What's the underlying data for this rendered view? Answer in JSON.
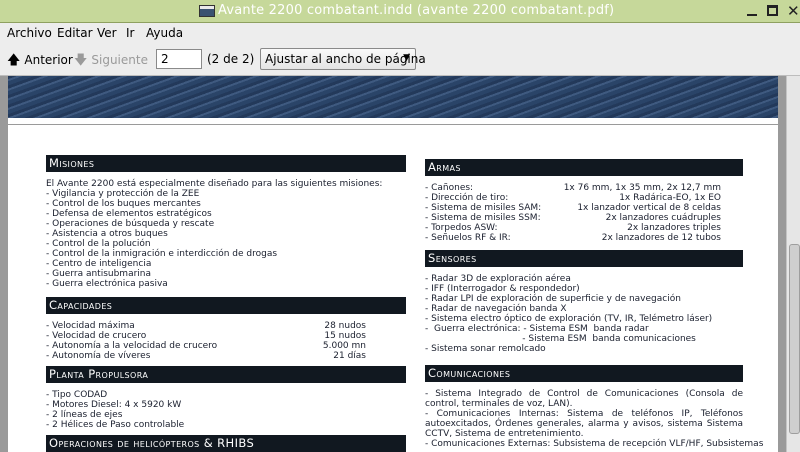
{
  "window": {
    "title": "Avante 2200 combatant.indd (avante 2200 combatant.pdf)"
  },
  "menu": [
    "Archivo",
    "Editar",
    "Ver",
    "Ir",
    "Ayuda"
  ],
  "toolbar": {
    "prev_label": "Anterior",
    "next_label": "Siguiente",
    "page_value": "2",
    "page_count": "(2 de 2)",
    "zoom_value": "Ajustar al ancho de página"
  },
  "document": {
    "misiones": {
      "title": "Misiones",
      "intro": "El Avante 2200 está especialmente diseñado para las siguientes misiones:",
      "items": [
        "- Vigilancia y protección de la ZEE",
        "- Control de los buques mercantes",
        "- Defensa de elementos estratégicos",
        "- Operaciones de búsqueda y rescate",
        "- Asistencia a otros buques",
        "- Control de la polución",
        "- Control de la inmigración e interdicción de drogas",
        "- Centro de inteligencia",
        "- Guerra antisubmarina",
        "- Guerra electrónica pasiva"
      ]
    },
    "capacidades": {
      "title": "Capacidades",
      "rows": [
        {
          "label": "- Velocidad máxima",
          "value": "28 nudos"
        },
        {
          "label": "- Velocidad de crucero",
          "value": "15 nudos"
        },
        {
          "label": "- Autonomía a la velocidad de crucero",
          "value": "5.000 mn"
        },
        {
          "label": "- Autonomía de víveres",
          "value": "21 días"
        }
      ]
    },
    "planta": {
      "title": "Planta Propulsora",
      "items": [
        "-  Tipo CODAD",
        "-  Motores Diesel: 4 x 5920 kW",
        "-  2 líneas de ejes",
        "-  2 Hélices de Paso controlable"
      ]
    },
    "operaciones": {
      "title": "Operaciones de helicópteros & RHIBS"
    },
    "armas": {
      "title": "Armas",
      "rows": [
        {
          "label": "-  Cañones:",
          "value": "1x 76 mm, 1x 35 mm, 2x 12,7 mm"
        },
        {
          "label": "-  Dirección de tiro:",
          "value": "1x Radárica-EO, 1x EO"
        },
        {
          "label": "-  Sistema de misiles SAM:",
          "value": "1x lanzador vertical de 8 celdas"
        },
        {
          "label": "-  Sistema de misiles SSM:",
          "value": "2x lanzadores cuádruples"
        },
        {
          "label": "-  Torpedos ASW:",
          "value": "2x lanzadores triples"
        },
        {
          "label": "-  Señuelos RF & IR:",
          "value": "2x lanzadores de 12 tubos"
        }
      ]
    },
    "sensores": {
      "title": "Sensores",
      "items": [
        "-  Radar 3D de exploración aérea",
        "-  IFF (Interrogador & respondedor)",
        "-  Radar LPI de exploración de superficie y de navegación",
        "-  Radar de navegación banda X",
        "-  Sistema electro óptico de exploración (TV, IR, Telémetro láser)",
        "-  Guerra electrónica: - Sistema ESM  banda radar",
        "                                  - Sistema ESM  banda comunicaciones",
        "-  Sistema sonar remolcado"
      ]
    },
    "comunicaciones": {
      "title": "Comunicaciones",
      "items": [
        "-  Sistema Integrado de Control de Comunicaciones (Consola de control, terminales de voz, LAN).",
        "-  Comunicaciones Internas: Sistema de teléfonos IP, Teléfonos autoexcitados, Órdenes generales, alarma y avisos, sistema Sistema CCTV, Sistema de entretenimiento.",
        "-  Comunicaciones Externas: Subsistema de recepción VLF/HF, Subsistemas"
      ]
    }
  }
}
